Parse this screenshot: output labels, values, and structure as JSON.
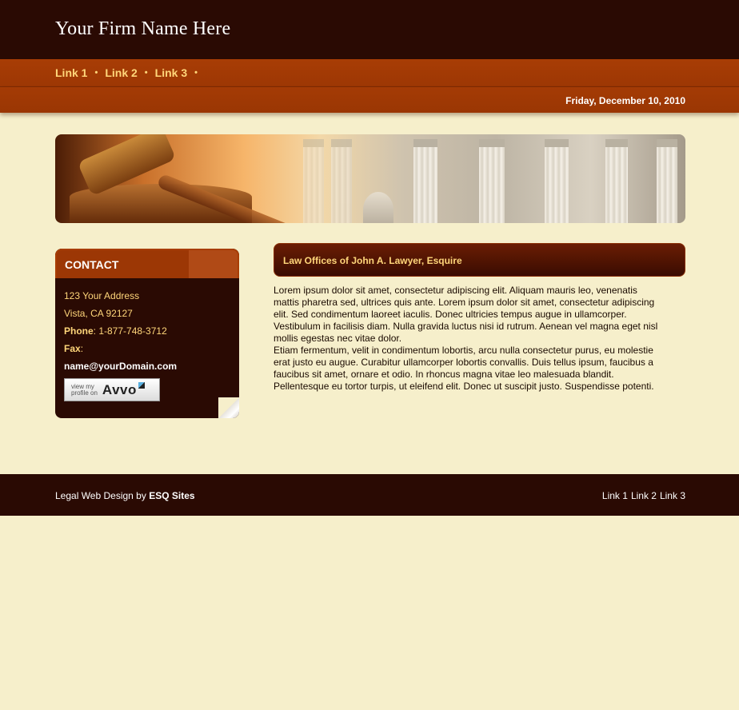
{
  "header": {
    "firm_name": "Your Firm Name Here"
  },
  "nav": {
    "links": [
      "Link 1",
      "Link 2",
      "Link 3"
    ],
    "separator": "•"
  },
  "datebar": {
    "date": "Friday, December 10, 2010"
  },
  "banner": {
    "image": "gavel-and-courthouse-columns"
  },
  "sidebar": {
    "title": "CONTACT",
    "address_line1": "123 Your Address",
    "address_line2": "Vista, CA 92127",
    "phone_label": "Phone",
    "phone": ": 1-877-748-3712",
    "fax_label": "Fax",
    "fax": ":",
    "email": "name@yourDomain.com",
    "avvo_small_line1": "view my",
    "avvo_small_line2": "profile on",
    "avvo_brand": "Avvo"
  },
  "main": {
    "title": "Law Offices of John A. Lawyer, Esquire",
    "paragraph1": "Lorem ipsum dolor sit amet, consectetur adipiscing elit. Aliquam mauris leo, venenatis mattis pharetra sed, ultrices quis ante. Lorem ipsum dolor sit amet, consectetur adipiscing elit. Sed condimentum laoreet iaculis. Donec ultricies tempus augue in ullamcorper. Vestibulum in facilisis diam. Nulla gravida luctus nisi id rutrum. Aenean vel magna eget nisl mollis egestas nec vitae dolor.",
    "paragraph2": "Etiam fermentum, velit in condimentum lobortis, arcu nulla consectetur purus, eu molestie erat justo eu augue. Curabitur ullamcorper lobortis convallis. Duis tellus ipsum, faucibus a faucibus sit amet, ornare et odio. In rhoncus magna vitae leo malesuada blandit. Pellentesque eu tortor turpis, ut eleifend elit. Donec ut suscipit justo. Suspendisse potenti."
  },
  "footer": {
    "credit_prefix": "Legal Web Design by ",
    "credit_brand": "ESQ Sites",
    "links": [
      "Link 1",
      "Link 2",
      "Link 3"
    ]
  },
  "colors": {
    "header_bg": "#2a0a03",
    "nav_bg": "#a83d05",
    "page_bg": "#f6efcb",
    "accent_text": "#ffd67a"
  }
}
